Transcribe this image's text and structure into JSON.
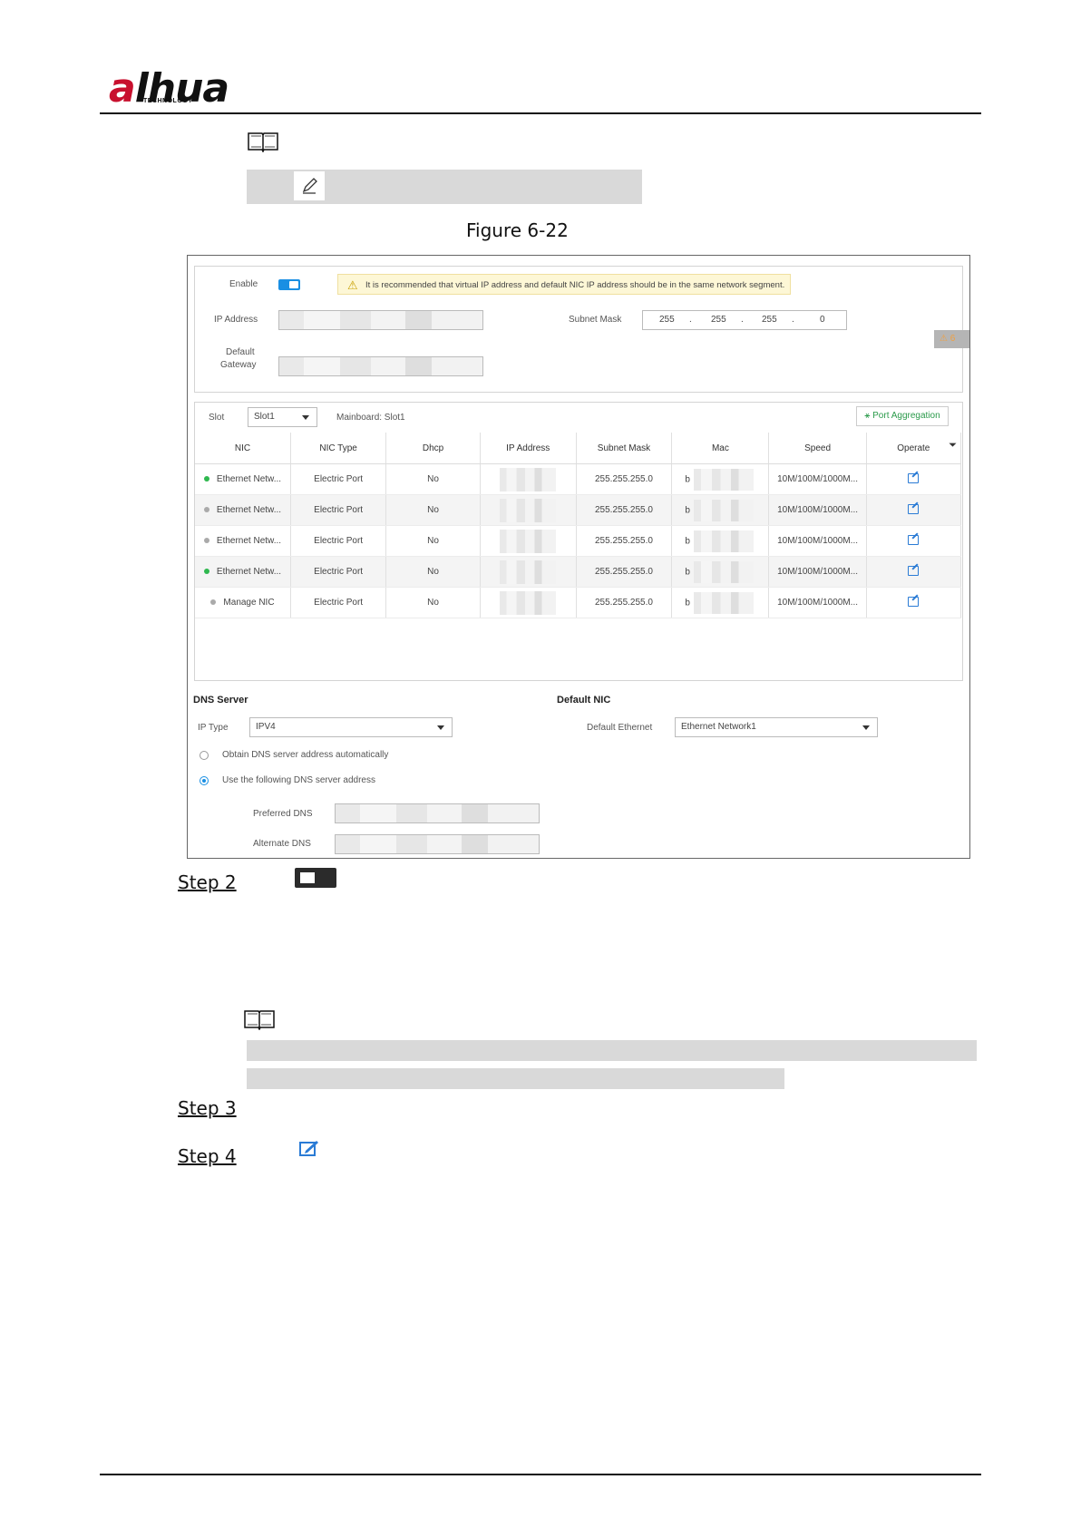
{
  "header": {
    "logo_text_a": "a",
    "logo_text_rest": "lhua",
    "logo_sub": "TECHNOLOGY"
  },
  "figure_caption": "Figure 6-22",
  "figure": {
    "enable_label": "Enable",
    "warning_text": "It is recommended that virtual IP address and default NIC IP address should be in the same network segment.",
    "ip_address_label": "IP Address",
    "subnet_mask_label": "Subnet Mask",
    "subnet_mask_parts": [
      "255",
      ".",
      "255",
      ".",
      "255",
      ".",
      "0"
    ],
    "default_gateway_label_1": "Default",
    "default_gateway_label_2": "Gateway",
    "alarm_badge": "6",
    "slot_label": "Slot",
    "slot_value": "Slot1",
    "mainboard_text": "Mainboard: Slot1",
    "port_aggregation": "Port Aggregation",
    "table": {
      "headers": [
        "NIC",
        "NIC Type",
        "Dhcp",
        "IP Address",
        "Subnet Mask",
        "Mac",
        "Speed",
        "Operate"
      ],
      "rows": [
        {
          "status": "green",
          "nic": "Ethernet Netw...",
          "type": "Electric Port",
          "dhcp": "No",
          "mask": "255.255.255.0",
          "mac": "b",
          "speed": "10M/100M/1000M..."
        },
        {
          "status": "gray",
          "nic": "Ethernet Netw...",
          "type": "Electric Port",
          "dhcp": "No",
          "mask": "255.255.255.0",
          "mac": "b",
          "speed": "10M/100M/1000M..."
        },
        {
          "status": "gray",
          "nic": "Ethernet Netw...",
          "type": "Electric Port",
          "dhcp": "No",
          "mask": "255.255.255.0",
          "mac": "b",
          "speed": "10M/100M/1000M..."
        },
        {
          "status": "green",
          "nic": "Ethernet Netw...",
          "type": "Electric Port",
          "dhcp": "No",
          "mask": "255.255.255.0",
          "mac": "b",
          "speed": "10M/100M/1000M..."
        },
        {
          "status": "gray",
          "nic": "Manage NIC",
          "type": "Electric Port",
          "dhcp": "No",
          "mask": "255.255.255.0",
          "mac": "b",
          "speed": "10M/100M/1000M..."
        }
      ]
    },
    "dns_server_title": "DNS Server",
    "ip_type_label": "IP Type",
    "ip_type_value": "IPV4",
    "obtain_dns": "Obtain DNS server address automatically",
    "use_dns": "Use the following DNS server address",
    "preferred_dns_label": "Preferred DNS",
    "alternate_dns_label": "Alternate DNS",
    "default_nic_title": "Default NIC",
    "default_ethernet_label": "Default Ethernet",
    "default_ethernet_value": "Ethernet Network1"
  },
  "steps": {
    "step2": "Step 2",
    "step3": "Step 3",
    "step4": "Step 4"
  },
  "colors": {
    "status_green": "#2fb84f",
    "status_gray": "#aaaaaa",
    "accent_blue": "#1a8fe3",
    "brand_red": "#c8102e"
  }
}
